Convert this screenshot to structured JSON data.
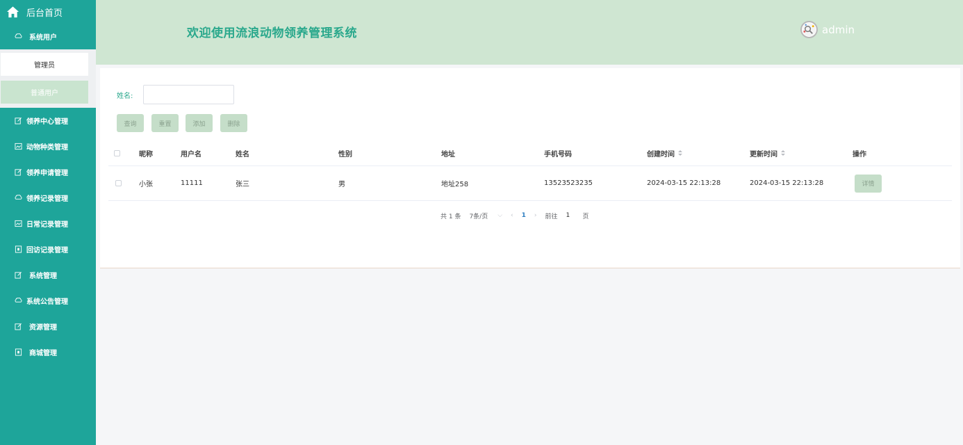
{
  "sidebar": {
    "home": "后台首页",
    "items": [
      {
        "label": "系统用户",
        "icon": "cloud-icon"
      },
      {
        "label": "领养中心管理",
        "icon": "edit-icon"
      },
      {
        "label": "动物种类管理",
        "icon": "image-icon"
      },
      {
        "label": "领养申请管理",
        "icon": "edit-icon"
      },
      {
        "label": "领养记录管理",
        "icon": "cloud-icon"
      },
      {
        "label": "日常记录管理",
        "icon": "image-icon"
      },
      {
        "label": "回访记录管理",
        "icon": "doc-icon"
      },
      {
        "label": "系统管理",
        "icon": "edit-icon"
      },
      {
        "label": "系统公告管理",
        "icon": "cloud-icon"
      },
      {
        "label": "资源管理",
        "icon": "edit-icon"
      },
      {
        "label": "商城管理",
        "icon": "doc-icon"
      }
    ],
    "submenu": [
      "管理员",
      "普通用户"
    ]
  },
  "header": {
    "title": "欢迎使用流浪动物领养管理系统",
    "username": "admin"
  },
  "search": {
    "label": "姓名:",
    "value": "",
    "placeholder": ""
  },
  "buttons": {
    "query": "查询",
    "reset": "重置",
    "add": "添加",
    "delete": "删除"
  },
  "table": {
    "headers": [
      "昵称",
      "用户名",
      "姓名",
      "性别",
      "地址",
      "手机号码",
      "创建时间",
      "更新时间",
      "操作"
    ],
    "rows": [
      {
        "nickname": "小张",
        "username": "11111",
        "name": "张三",
        "gender": "男",
        "address": "地址258",
        "phone": "13523523235",
        "created": "2024-03-15 22:13:28",
        "updated": "2024-03-15 22:13:28",
        "action": "详情"
      }
    ]
  },
  "pagination": {
    "total": "共 1 条",
    "page_size": "7条/页",
    "current_page": "1",
    "goto_label": "前往",
    "goto_value": "1",
    "page_suffix": "页"
  },
  "colors": {
    "sidebar_bg": "#1ea59a",
    "header_bg": "#cfe6d2",
    "title_color": "#2aa88c",
    "button_bg": "#c5dec9"
  }
}
